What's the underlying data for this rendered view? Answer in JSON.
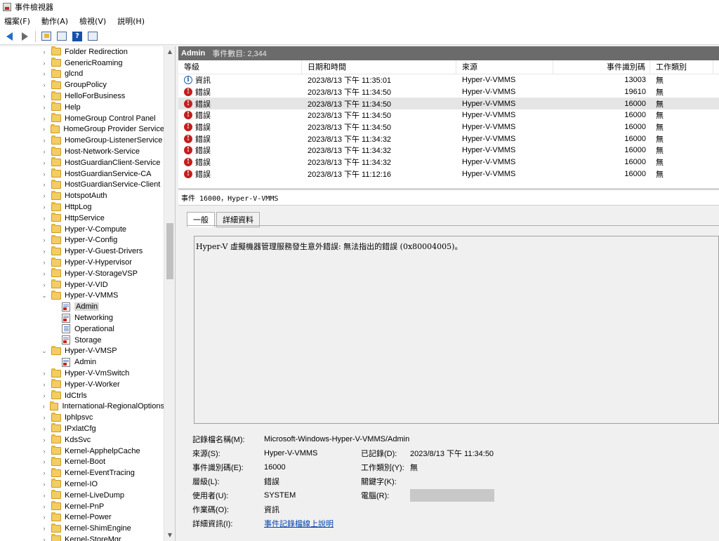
{
  "window": {
    "title": "事件檢視器"
  },
  "menu": [
    "檔案(F)",
    "動作(A)",
    "檢視(V)",
    "説明(H)"
  ],
  "tree": {
    "items": [
      {
        "label": "Folder Redirection",
        "kind": "folder",
        "level": 0,
        "chev": ">"
      },
      {
        "label": "GenericRoaming",
        "kind": "folder",
        "level": 0,
        "chev": ">"
      },
      {
        "label": "glcnd",
        "kind": "folder",
        "level": 0,
        "chev": ">"
      },
      {
        "label": "GroupPolicy",
        "kind": "folder",
        "level": 0,
        "chev": ">"
      },
      {
        "label": "HelloForBusiness",
        "kind": "folder",
        "level": 0,
        "chev": ">"
      },
      {
        "label": "Help",
        "kind": "folder",
        "level": 0,
        "chev": ">"
      },
      {
        "label": "HomeGroup Control Panel",
        "kind": "folder",
        "level": 0,
        "chev": ">"
      },
      {
        "label": "HomeGroup Provider Service",
        "kind": "folder",
        "level": 0,
        "chev": ">"
      },
      {
        "label": "HomeGroup-ListenerService",
        "kind": "folder",
        "level": 0,
        "chev": ">"
      },
      {
        "label": "Host-Network-Service",
        "kind": "folder",
        "level": 0,
        "chev": ">"
      },
      {
        "label": "HostGuardianClient-Service",
        "kind": "folder",
        "level": 0,
        "chev": ">"
      },
      {
        "label": "HostGuardianService-CA",
        "kind": "folder",
        "level": 0,
        "chev": ">"
      },
      {
        "label": "HostGuardianService-Client",
        "kind": "folder",
        "level": 0,
        "chev": ">"
      },
      {
        "label": "HotspotAuth",
        "kind": "folder",
        "level": 0,
        "chev": ">"
      },
      {
        "label": "HttpLog",
        "kind": "folder",
        "level": 0,
        "chev": ">"
      },
      {
        "label": "HttpService",
        "kind": "folder",
        "level": 0,
        "chev": ">"
      },
      {
        "label": "Hyper-V-Compute",
        "kind": "folder",
        "level": 0,
        "chev": ">"
      },
      {
        "label": "Hyper-V-Config",
        "kind": "folder",
        "level": 0,
        "chev": ">"
      },
      {
        "label": "Hyper-V-Guest-Drivers",
        "kind": "folder",
        "level": 0,
        "chev": ">"
      },
      {
        "label": "Hyper-V-Hypervisor",
        "kind": "folder",
        "level": 0,
        "chev": ">"
      },
      {
        "label": "Hyper-V-StorageVSP",
        "kind": "folder",
        "level": 0,
        "chev": ">"
      },
      {
        "label": "Hyper-V-VID",
        "kind": "folder",
        "level": 0,
        "chev": ">"
      },
      {
        "label": "Hyper-V-VMMS",
        "kind": "folder",
        "level": 0,
        "chev": "v"
      },
      {
        "label": "Admin",
        "kind": "log-red",
        "level": 1,
        "chev": "",
        "selected": true
      },
      {
        "label": "Networking",
        "kind": "log-red",
        "level": 1,
        "chev": ""
      },
      {
        "label": "Operational",
        "kind": "log-plain",
        "level": 1,
        "chev": ""
      },
      {
        "label": "Storage",
        "kind": "log-red",
        "level": 1,
        "chev": ""
      },
      {
        "label": "Hyper-V-VMSP",
        "kind": "folder",
        "level": 0,
        "chev": "v"
      },
      {
        "label": "Admin",
        "kind": "log-red",
        "level": 1,
        "chev": ""
      },
      {
        "label": "Hyper-V-VmSwitch",
        "kind": "folder",
        "level": 0,
        "chev": ">"
      },
      {
        "label": "Hyper-V-Worker",
        "kind": "folder",
        "level": 0,
        "chev": ">"
      },
      {
        "label": "IdCtrls",
        "kind": "folder",
        "level": 0,
        "chev": ">"
      },
      {
        "label": "International-RegionalOptions",
        "kind": "folder",
        "level": 0,
        "chev": ">"
      },
      {
        "label": "Iphlpsvc",
        "kind": "folder",
        "level": 0,
        "chev": ">"
      },
      {
        "label": "IPxlatCfg",
        "kind": "folder",
        "level": 0,
        "chev": ">"
      },
      {
        "label": "KdsSvc",
        "kind": "folder",
        "level": 0,
        "chev": ">"
      },
      {
        "label": "Kernel-ApphelpCache",
        "kind": "folder",
        "level": 0,
        "chev": ">"
      },
      {
        "label": "Kernel-Boot",
        "kind": "folder",
        "level": 0,
        "chev": ">"
      },
      {
        "label": "Kernel-EventTracing",
        "kind": "folder",
        "level": 0,
        "chev": ">"
      },
      {
        "label": "Kernel-IO",
        "kind": "folder",
        "level": 0,
        "chev": ">"
      },
      {
        "label": "Kernel-LiveDump",
        "kind": "folder",
        "level": 0,
        "chev": ">"
      },
      {
        "label": "Kernel-PnP",
        "kind": "folder",
        "level": 0,
        "chev": ">"
      },
      {
        "label": "Kernel-Power",
        "kind": "folder",
        "level": 0,
        "chev": ">"
      },
      {
        "label": "Kernel-ShimEngine",
        "kind": "folder",
        "level": 0,
        "chev": ">"
      },
      {
        "label": "Kernel-StoreMgr",
        "kind": "folder",
        "level": 0,
        "chev": ">"
      }
    ]
  },
  "events": {
    "log_name": "Admin",
    "count_text": "事件數目: 2,344",
    "columns": [
      "等級",
      "日期和時間",
      "來源",
      "事件識別碼",
      "工作類別"
    ],
    "rows": [
      {
        "level": "資訊",
        "type": "info",
        "datetime": "2023/8/13 下午 11:35:01",
        "source": "Hyper-V-VMMS",
        "id": "13003",
        "task": "無"
      },
      {
        "level": "錯誤",
        "type": "err",
        "datetime": "2023/8/13 下午 11:34:50",
        "source": "Hyper-V-VMMS",
        "id": "19610",
        "task": "無"
      },
      {
        "level": "錯誤",
        "type": "err",
        "datetime": "2023/8/13 下午 11:34:50",
        "source": "Hyper-V-VMMS",
        "id": "16000",
        "task": "無",
        "selected": true
      },
      {
        "level": "錯誤",
        "type": "err",
        "datetime": "2023/8/13 下午 11:34:50",
        "source": "Hyper-V-VMMS",
        "id": "16000",
        "task": "無"
      },
      {
        "level": "錯誤",
        "type": "err",
        "datetime": "2023/8/13 下午 11:34:50",
        "source": "Hyper-V-VMMS",
        "id": "16000",
        "task": "無"
      },
      {
        "level": "錯誤",
        "type": "err",
        "datetime": "2023/8/13 下午 11:34:32",
        "source": "Hyper-V-VMMS",
        "id": "16000",
        "task": "無"
      },
      {
        "level": "錯誤",
        "type": "err",
        "datetime": "2023/8/13 下午 11:34:32",
        "source": "Hyper-V-VMMS",
        "id": "16000",
        "task": "無"
      },
      {
        "level": "錯誤",
        "type": "err",
        "datetime": "2023/8/13 下午 11:34:32",
        "source": "Hyper-V-VMMS",
        "id": "16000",
        "task": "無"
      },
      {
        "level": "錯誤",
        "type": "err",
        "datetime": "2023/8/13 下午 11:12:16",
        "source": "Hyper-V-VMMS",
        "id": "16000",
        "task": "無"
      }
    ]
  },
  "detail": {
    "title": "事件 16000，Hyper-V-VMMS",
    "tabs": [
      "一般",
      "詳細資料"
    ],
    "message": "Hyper-V 虛擬機器管理服務發生意外錯誤: 無法指出的錯誤 (0x80004005)。",
    "props": {
      "log_name_label": "記錄檔名稱(M):",
      "log_name_value": "Microsoft-Windows-Hyper-V-VMMS/Admin",
      "source_label": "來源(S):",
      "source_value": "Hyper-V-VMMS",
      "logged_label": "已記錄(D):",
      "logged_value": "2023/8/13 下午 11:34:50",
      "id_label": "事件識別碼(E):",
      "id_value": "16000",
      "task_label": "工作類別(Y):",
      "task_value": "無",
      "level_label": "層級(L):",
      "level_value": "錯誤",
      "keywords_label": "關鍵字(K):",
      "keywords_value": "",
      "user_label": "使用者(U):",
      "user_value": "SYSTEM",
      "computer_label": "電腦(R):",
      "opcode_label": "作業碼(O):",
      "opcode_value": "資訊",
      "more_label": "詳細資訊(I):",
      "more_link": "事件記錄檔線上說明"
    }
  }
}
